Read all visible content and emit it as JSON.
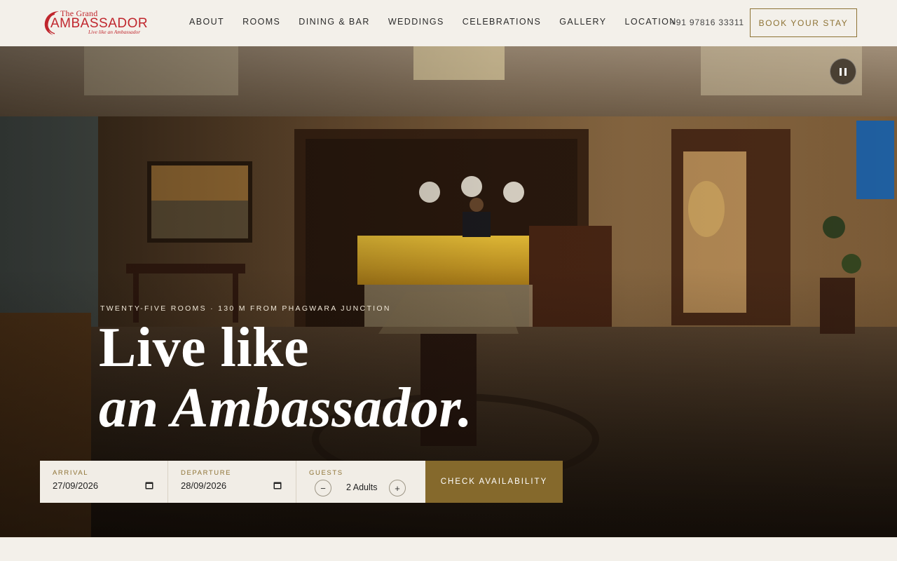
{
  "brand": {
    "small": "The Grand",
    "name": "AMBASSADOR",
    "tagline": "Live like an Ambassador",
    "color": "#c0262d"
  },
  "nav": {
    "items": [
      {
        "label": "ABOUT"
      },
      {
        "label": "ROOMS"
      },
      {
        "label": "DINING & BAR"
      },
      {
        "label": "WEDDINGS"
      },
      {
        "label": "CELEBRATIONS"
      },
      {
        "label": "GALLERY"
      },
      {
        "label": "LOCATION"
      }
    ]
  },
  "header": {
    "phone": "+91 97816 33311",
    "book_label": "BOOK YOUR STAY"
  },
  "hero": {
    "kicker": "TWENTY-FIVE ROOMS · 130 M FROM PHAGWARA JUNCTION",
    "headline_line1": "Live like",
    "headline_line2": "an Ambassador.",
    "pause_icon": "pause-icon"
  },
  "booking": {
    "arrival_label": "ARRIVAL",
    "arrival_value": "27/09/2026",
    "departure_label": "DEPARTURE",
    "departure_value": "28/09/2026",
    "guests_label": "GUESTS",
    "guests_value": "2 Adults",
    "minus": "−",
    "plus": "+",
    "check_label": "CHECK AVAILABILITY"
  },
  "colors": {
    "accent": "#85692c",
    "background": "#f3f0ea"
  }
}
